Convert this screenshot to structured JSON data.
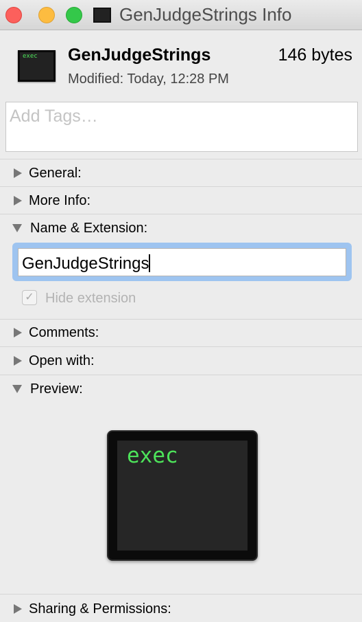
{
  "window": {
    "title": "GenJudgeStrings Info",
    "colors": {
      "close": "#fc605c",
      "minimize": "#fdbc40",
      "zoom": "#34c84a"
    }
  },
  "header": {
    "name": "GenJudgeStrings",
    "size": "146 bytes",
    "modified": "Modified: Today, 12:28 PM",
    "icon_text": "exec"
  },
  "tags": {
    "placeholder": "Add Tags…"
  },
  "sections": {
    "general": "General:",
    "more_info": "More Info:",
    "name_ext": "Name & Extension:",
    "comments": "Comments:",
    "open_with": "Open with:",
    "preview": "Preview:",
    "sharing": "Sharing & Permissions:"
  },
  "name_field": {
    "value": "GenJudgeStrings",
    "hide_extension_label": "Hide extension",
    "hide_extension_checked": true
  },
  "preview": {
    "icon_text": "exec"
  }
}
